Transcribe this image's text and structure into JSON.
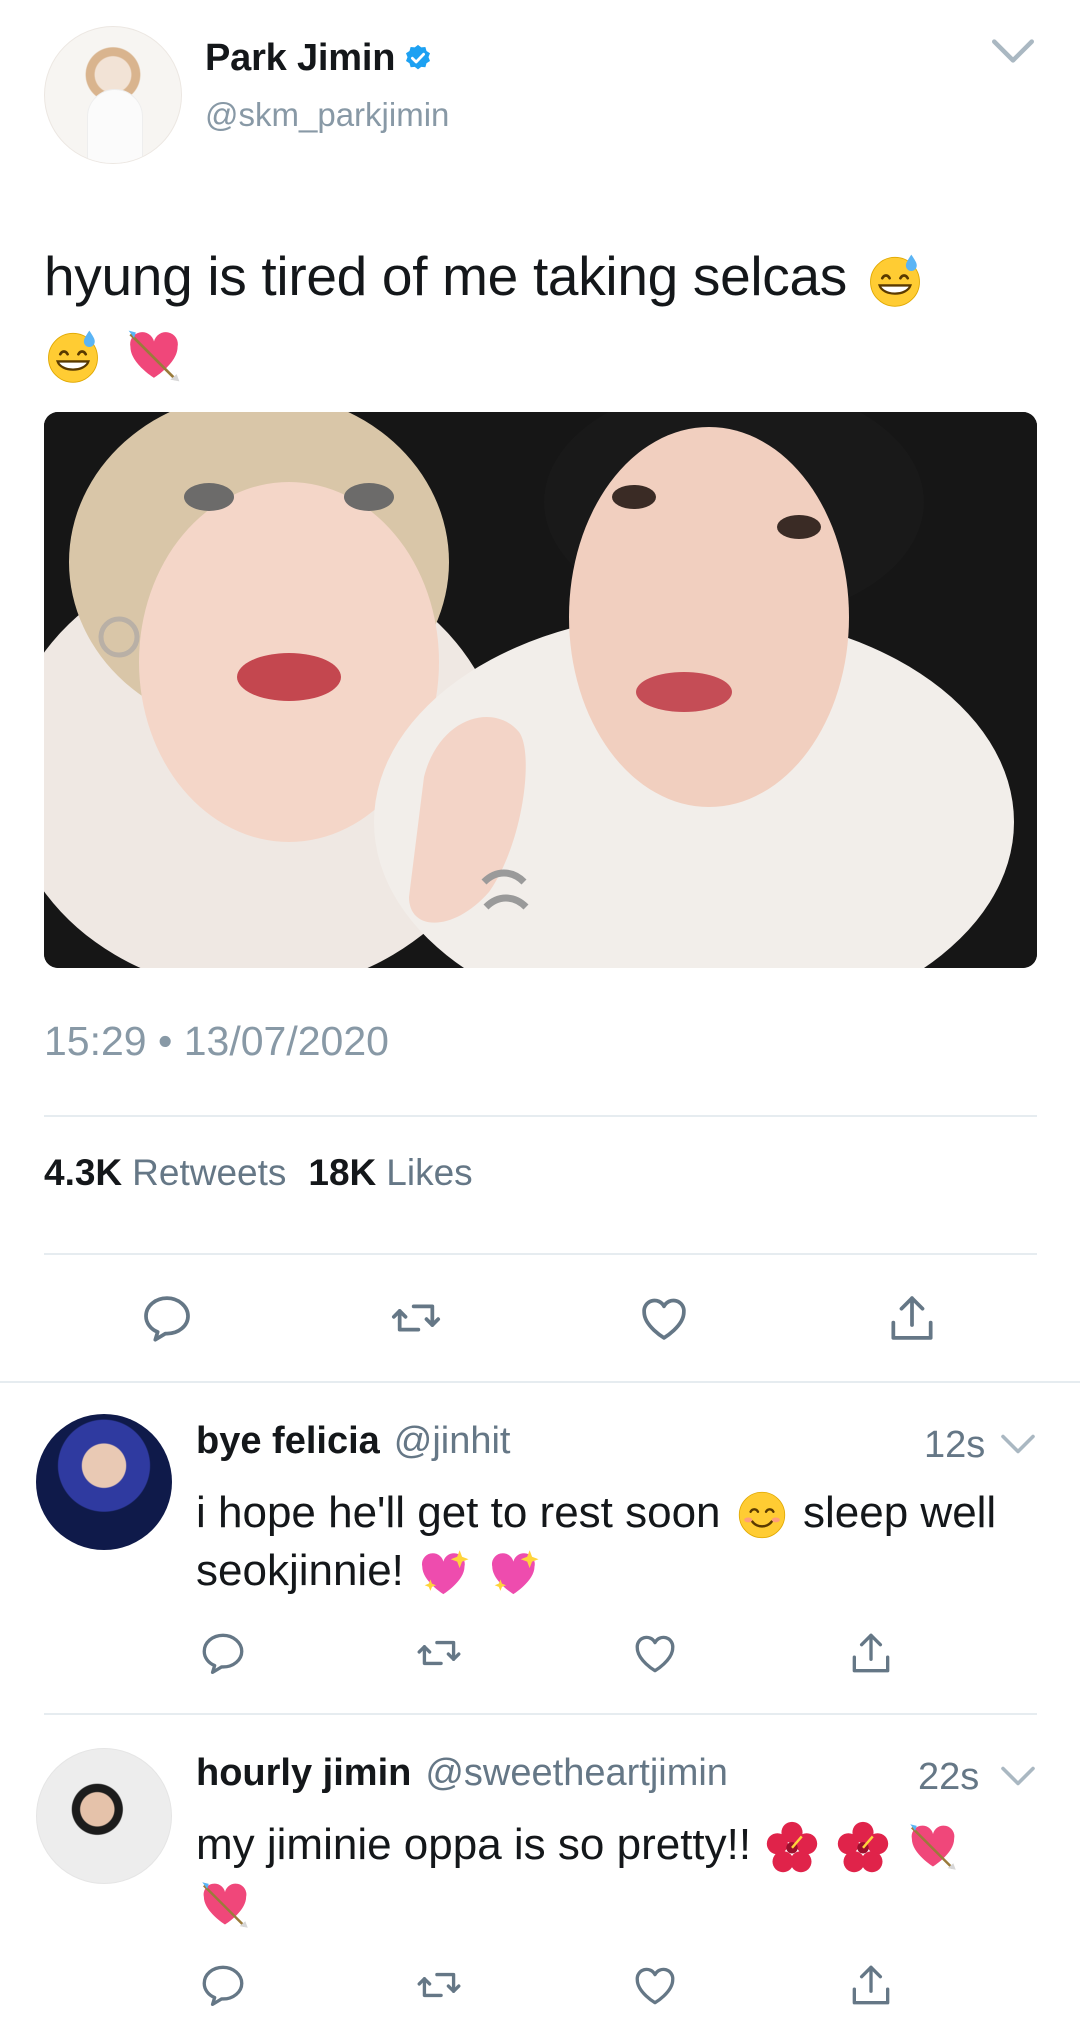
{
  "tweet": {
    "display_name": "Park Jimin",
    "handle": "@skm_parkjimin",
    "text_line1": "hyung is tired of me taking selcas",
    "timestamp": "15:29 • 13/07/2020",
    "retweets_count": "4.3K",
    "retweets_label": "Retweets",
    "likes_count": "18K",
    "likes_label": "Likes",
    "emojis": [
      "grinning-sweat-emoji",
      "grinning-sweat-emoji",
      "heart-with-arrow-emoji"
    ]
  },
  "replies": [
    {
      "display_name": "bye felicia",
      "handle": "@jinhit",
      "time": "12s",
      "text_part1": "i hope he'll get to rest soon",
      "text_part2": "sleep well seokjinnie!",
      "emojis": [
        "smiling-face-emoji",
        "sparkling-heart-emoji",
        "sparkling-heart-emoji"
      ]
    },
    {
      "display_name": "hourly jimin",
      "handle": "@sweetheartjimin",
      "time": "22s",
      "text_part1": "my jiminie oppa is so pretty!!",
      "emojis": [
        "hibiscus-emoji",
        "hibiscus-emoji",
        "heart-with-arrow-emoji",
        "heart-with-arrow-emoji"
      ]
    }
  ],
  "colors": {
    "text_primary": "#14171a",
    "text_secondary": "#657786",
    "handle_gray": "#8899a6",
    "verified_blue": "#1da1f2",
    "icon_gray": "#657786",
    "divider": "#e6ecf0"
  }
}
